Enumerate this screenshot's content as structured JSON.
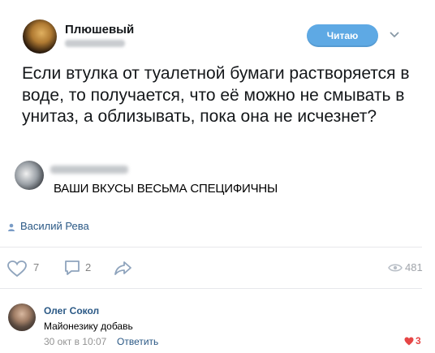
{
  "post": {
    "author_name": "Плюшевый",
    "follow_label": "Читаю",
    "text": "Если втулка от туалетной бумаги растворяется в воде, то получается, что её можно не смывать в унитаз, а облизывать, пока она не исчезнет?"
  },
  "meme": {
    "text": "ВАШИ ВКУСЫ ВЕСЬМА СПЕЦИФИЧНЫ"
  },
  "source_author": "Василий Рева",
  "actions": {
    "likes": "7",
    "comments": "2",
    "views": "481"
  },
  "comment": {
    "author": "Олег Сокол",
    "text": "Майонезику добавь",
    "time": "30 окт в 10:07",
    "reply_label": "Ответить",
    "likes": "3"
  },
  "colors": {
    "link": "#2a5885",
    "follow_button": "#5ea9e4",
    "like_red": "#e64646"
  },
  "icons": [
    "chevron-down-icon",
    "person-icon",
    "heart-icon",
    "comment-icon",
    "share-icon",
    "eye-icon"
  ]
}
